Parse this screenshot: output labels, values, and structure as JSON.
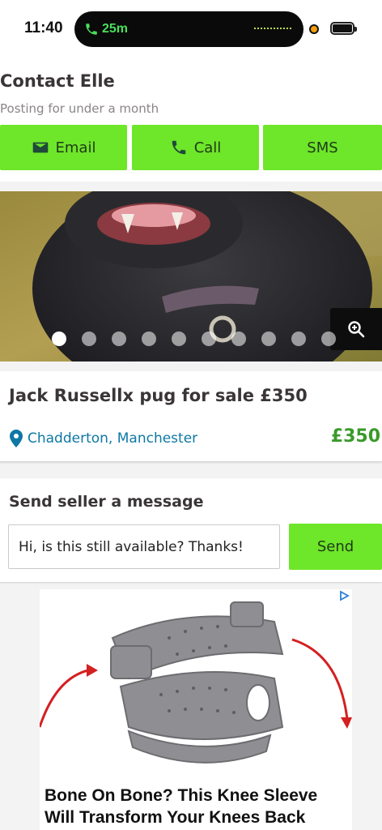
{
  "status_bar": {
    "time": "11:40",
    "call_duration": "25m",
    "call_color": "#4ade5a"
  },
  "contact": {
    "title": "Contact Elle",
    "subtitle": "Posting for under a month",
    "buttons": [
      {
        "label": "Email",
        "icon": "envelope-icon"
      },
      {
        "label": "Call",
        "icon": "phone-icon"
      },
      {
        "label": "SMS",
        "icon": ""
      }
    ],
    "button_color": "#6ee629"
  },
  "gallery": {
    "image_count": 10,
    "active_index": 0,
    "zoom_icon": "zoom-in-icon"
  },
  "listing": {
    "title": "Jack Russellx pug for sale £350",
    "location": "Chadderton, Manchester",
    "price": "£350",
    "location_color": "#0e78a5",
    "price_color": "#3a9a2a"
  },
  "message": {
    "heading": "Send seller a message",
    "input_value": "Hi, is this still available? Thanks!",
    "send_label": "Send"
  },
  "ad": {
    "headline_line1": "Bone On Bone? This Knee Sleeve",
    "headline_line2": "Will Transform Your Knees Back",
    "adchoices_icon": "adchoices-icon"
  }
}
